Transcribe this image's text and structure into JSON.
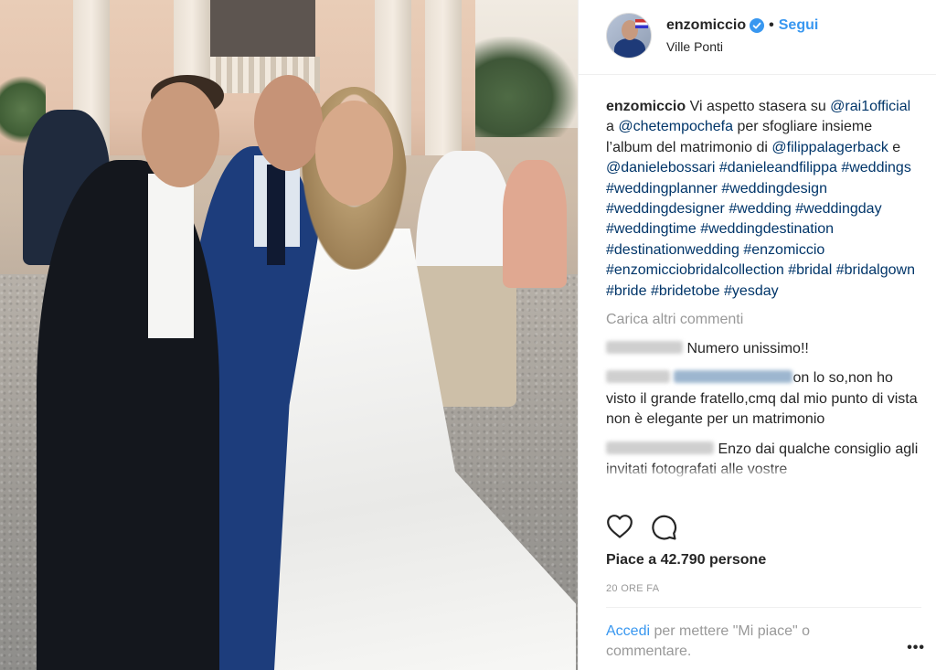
{
  "header": {
    "username": "enzomiccio",
    "follow_label": "Segui",
    "location": "Ville Ponti",
    "separator": "•"
  },
  "caption": {
    "username": "enzomiccio",
    "text_1": "Vi aspetto stasera su",
    "mention_1": "@rai1official",
    "text_2": "a",
    "mention_2": "@chetempochefa",
    "text_3": "per sfogliare insieme l’album del matrimonio di",
    "mention_3": "@filippalagerback",
    "text_4": "e",
    "mention_4": "@danielebossari",
    "hashtags": [
      "#danieleandfilippa",
      "#weddings",
      "#weddingplanner",
      "#weddingdesign",
      "#weddingdesigner",
      "#wedding",
      "#weddingday",
      "#weddingtime",
      "#weddingdestination",
      "#destinationwedding",
      "#enzomiccio",
      "#enzomicciobridalcollection",
      "#bridal",
      "#bridalgown",
      "#bride",
      "#bridetobe",
      "#yesday"
    ]
  },
  "load_more_label": "Carica altri commenti",
  "comments": [
    {
      "text": "Numero unissimo!!"
    },
    {
      "text": "on lo so,non ho visto il grande fratello,cmq dal mio punto di vista non è elegante per un matrimonio"
    },
    {
      "text": "Enzo dai qualche consiglio agli invitati fotografati alle vostre"
    }
  ],
  "likes": {
    "text": "Piace a 42.790 persone"
  },
  "timestamp": "20 ORE FA",
  "login": {
    "link": "Accedi",
    "text": "per mettere \"Mi piace\" o commentare."
  },
  "more_label": "•••",
  "colors": {
    "link_blue": "#3897f0",
    "mention_navy": "#003569",
    "muted_gray": "#999999",
    "text": "#262626"
  }
}
